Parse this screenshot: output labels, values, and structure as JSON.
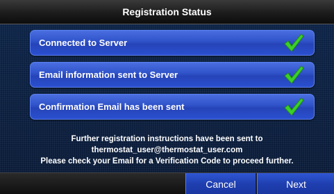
{
  "header": {
    "title": "Registration Status"
  },
  "status_items": [
    {
      "label": "Connected to Server",
      "icon": "check-icon"
    },
    {
      "label": "Email information sent to Server",
      "icon": "check-icon"
    },
    {
      "label": "Confirmation Email has been sent",
      "icon": "check-icon"
    }
  ],
  "message": {
    "line1": "Further registration instructions have been sent to",
    "line2": "thermostat_user@thermostat_user.com",
    "line3": "Please check your Email for a Verification Code to proceed further."
  },
  "footer": {
    "cancel_label": "Cancel",
    "next_label": "Next"
  },
  "colors": {
    "button_blue": "#2f52c9",
    "check_green": "#3ccf2a",
    "background": "#0b1e3d"
  }
}
